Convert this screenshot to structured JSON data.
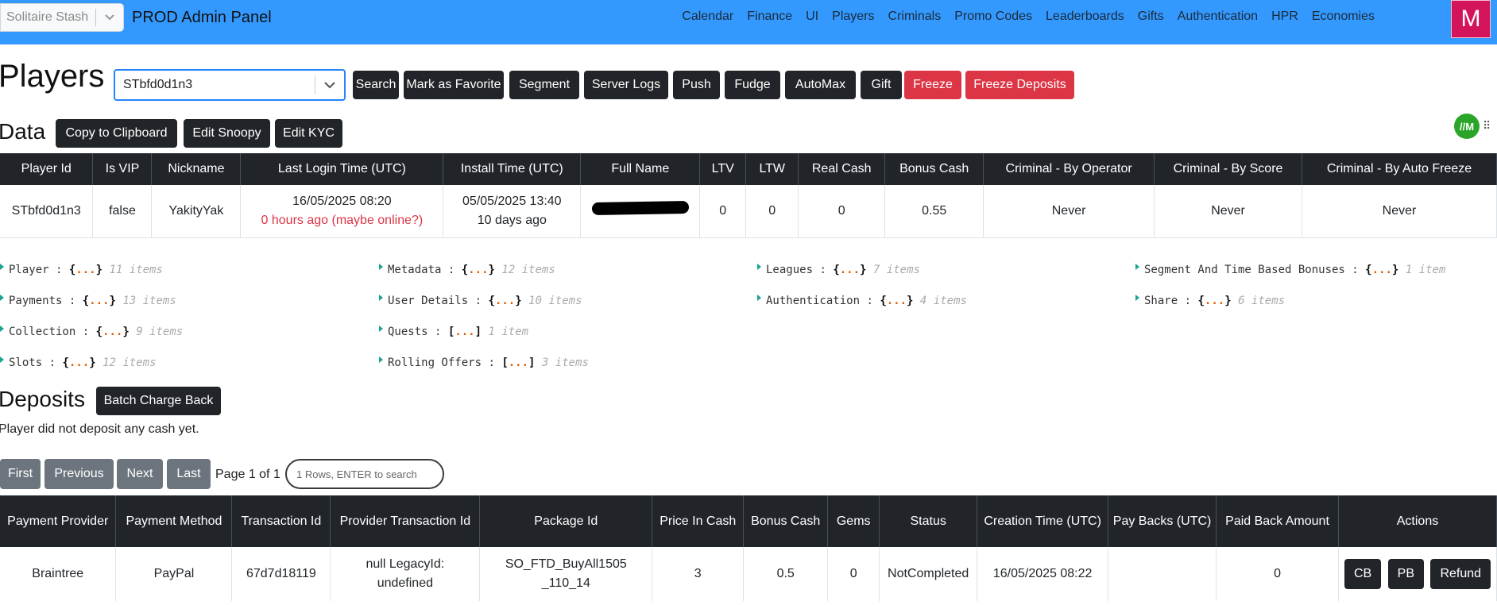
{
  "navbar": {
    "app_select": "Solitaire Stash",
    "brand": "PROD Admin Panel",
    "links": [
      "Calendar",
      "Finance",
      "UI",
      "Players",
      "Criminals",
      "Promo Codes",
      "Leaderboards",
      "Gifts",
      "Authentication",
      "HPR",
      "Economies"
    ],
    "avatar": "M"
  },
  "players": {
    "title": "Players",
    "selected_player": "STbfd0d1n3",
    "buttons": [
      "Search",
      "Mark as Favorite",
      "Segment",
      "Server Logs",
      "Push",
      "Fudge",
      "AutoMax",
      "Gift"
    ],
    "danger_buttons": [
      "Freeze",
      "Freeze Deposits"
    ]
  },
  "data": {
    "title": "Data",
    "buttons": [
      "Copy to Clipboard",
      "Edit Snoopy",
      "Edit KYC"
    ],
    "headers": [
      "Player Id",
      "Is VIP",
      "Nickname",
      "Last Login Time (UTC)",
      "Install Time (UTC)",
      "Full Name",
      "LTV",
      "LTW",
      "Real Cash",
      "Bonus Cash",
      "Criminal - By Operator",
      "Criminal - By Score",
      "Criminal - By Auto Freeze"
    ],
    "row": {
      "player_id": "STbfd0d1n3",
      "is_vip": "false",
      "nickname": "YakityYak",
      "last_login": "16/05/2025 08:20",
      "last_login_note": "0 hours ago (maybe online?)",
      "install_time": "05/05/2025 13:40",
      "install_note": "10 days ago",
      "ltv": "0",
      "ltw": "0",
      "real_cash": "0",
      "bonus_cash": "0.55",
      "crim_operator": "Never",
      "crim_score": "Never",
      "crim_auto": "Never"
    }
  },
  "tree": [
    {
      "key": "Player",
      "open": "{",
      "close": "}",
      "count": "11 items"
    },
    {
      "key": "Metadata",
      "open": "{",
      "close": "}",
      "count": "12 items"
    },
    {
      "key": "Leagues",
      "open": "{",
      "close": "}",
      "count": "7 items"
    },
    {
      "key": "Segment And Time Based Bonuses",
      "open": "{",
      "close": "}",
      "count": "1 item"
    },
    {
      "key": "Payments",
      "open": "{",
      "close": "}",
      "count": "13 items"
    },
    {
      "key": "User Details",
      "open": "{",
      "close": "}",
      "count": "10 items"
    },
    {
      "key": "Authentication",
      "open": "{",
      "close": "}",
      "count": "4 items"
    },
    {
      "key": "Share",
      "open": "{",
      "close": "}",
      "count": "6 items"
    },
    {
      "key": "Collection",
      "open": "{",
      "close": "}",
      "count": "9 items"
    },
    {
      "key": "Quests",
      "open": "[",
      "close": "]",
      "count": "1 item"
    },
    {
      "key": "Slots",
      "open": "{",
      "close": "}",
      "count": "12 items"
    },
    {
      "key": "Rolling Offers",
      "open": "[",
      "close": "]",
      "count": "3 items"
    }
  ],
  "deposits": {
    "title": "Deposits",
    "batch_button": "Batch Charge Back",
    "note": "Player did not deposit any cash yet.",
    "pager": [
      "First",
      "Previous",
      "Next",
      "Last"
    ],
    "page_info": "Page 1 of 1",
    "search_placeholder": "1 Rows, ENTER to search",
    "headers": [
      "Payment Provider",
      "Payment Method",
      "Transaction Id",
      "Provider Transaction Id",
      "Package Id",
      "Price In Cash",
      "Bonus Cash",
      "Gems",
      "Status",
      "Creation Time (UTC)",
      "Pay Backs (UTC)",
      "Paid Back Amount",
      "Actions"
    ],
    "row": {
      "provider": "Braintree",
      "method": "PayPal",
      "txn_id": "67d7d18119",
      "provider_txn": "null LegacyId: undefined",
      "package_id": "SO_FTD_BuyAll1505_110_14",
      "price": "3",
      "bonus": "0.5",
      "gems": "0",
      "status": "NotCompleted",
      "created": "16/05/2025 08:22",
      "paybacks": "",
      "paid_back": "0",
      "actions": [
        "CB",
        "PB",
        "Refund"
      ]
    }
  },
  "widget": {
    "badge": "//M",
    "grip": "⠿"
  }
}
